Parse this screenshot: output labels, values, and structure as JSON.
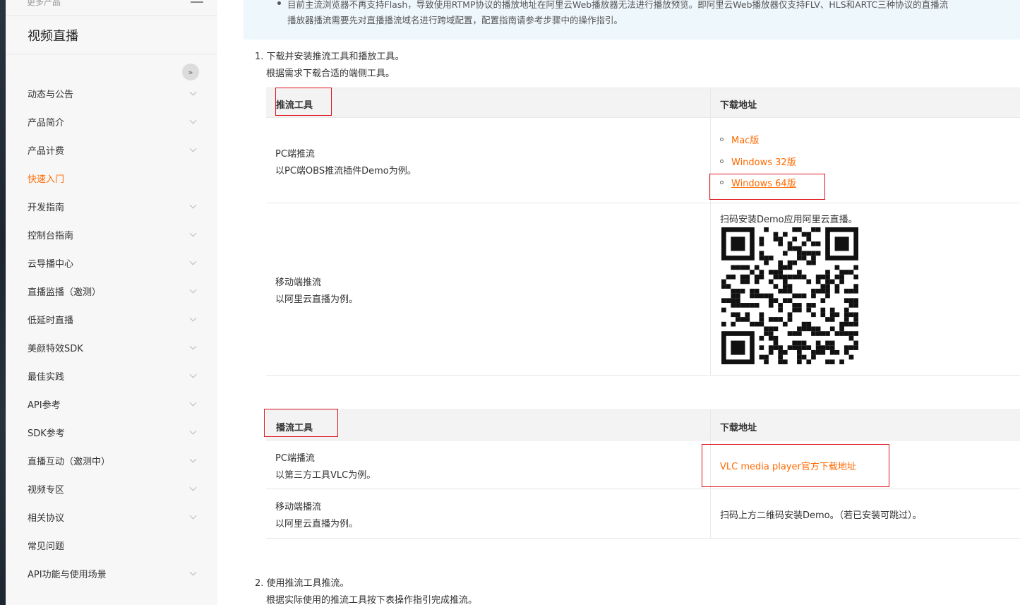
{
  "sidebar": {
    "more_label": "更多产品",
    "title": "视频直播",
    "items": [
      {
        "label": "动态与公告",
        "active": false,
        "expandable": true
      },
      {
        "label": "产品简介",
        "active": false,
        "expandable": true
      },
      {
        "label": "产品计费",
        "active": false,
        "expandable": true
      },
      {
        "label": "快速入门",
        "active": true,
        "expandable": false
      },
      {
        "label": "开发指南",
        "active": false,
        "expandable": true
      },
      {
        "label": "控制台指南",
        "active": false,
        "expandable": true
      },
      {
        "label": "云导播中心",
        "active": false,
        "expandable": true
      },
      {
        "label": "直播监播（邀测）",
        "active": false,
        "expandable": true
      },
      {
        "label": "低延时直播",
        "active": false,
        "expandable": true
      },
      {
        "label": "美颜特效SDK",
        "active": false,
        "expandable": true
      },
      {
        "label": "最佳实践",
        "active": false,
        "expandable": true
      },
      {
        "label": "API参考",
        "active": false,
        "expandable": true
      },
      {
        "label": "SDK参考",
        "active": false,
        "expandable": true
      },
      {
        "label": "直播互动（邀测中）",
        "active": false,
        "expandable": true
      },
      {
        "label": "视频专区",
        "active": false,
        "expandable": true
      },
      {
        "label": "相关协议",
        "active": false,
        "expandable": true
      },
      {
        "label": "常见问题",
        "active": false,
        "expandable": false
      },
      {
        "label": "API功能与使用场景",
        "active": false,
        "expandable": true
      }
    ]
  },
  "notice": {
    "line1": "目前主流浏览器不再支持Flash，导致使用RTMP协议的播放地址在阿里云Web播放器无法进行播放预览。即阿里云Web播放器仅支持FLV、HLS和ARTC三种协议的直播流",
    "line2": "播放器播流需要先对直播播流域名进行跨域配置，配置指南请参考步骤中的操作指引。"
  },
  "step1": {
    "title": "1. 下载并安装推流工具和播放工具。",
    "sub": "根据需求下载合适的端侧工具。"
  },
  "push_table": {
    "col1": "推流工具",
    "col2": "下载地址",
    "rows": [
      {
        "title": "PC端推流",
        "desc": "以PC端OBS推流插件Demo为例。",
        "links": [
          "Mac版",
          "Windows 32版",
          "Windows 64版"
        ]
      },
      {
        "title": "移动端推流",
        "desc": "以阿里云直播为例。",
        "note": "扫码安装Demo应用阿里云直播。"
      }
    ]
  },
  "play_table": {
    "col1": "播流工具",
    "col2": "下载地址",
    "rows": [
      {
        "title": "PC端播流",
        "desc": "以第三方工具VLC为例。",
        "link": "VLC media player官方下载地址"
      },
      {
        "title": "移动端播流",
        "desc": "以阿里云直播为例。",
        "note": "扫码上方二维码安装Demo。（若已安装可跳过）。"
      }
    ]
  },
  "step2": {
    "title": "2. 使用推流工具推流。",
    "sub": "根据实际使用的推流工具按下表操作指引完成推流。"
  },
  "colors": {
    "accent": "#ff6a00",
    "highlight": "#e0141e"
  }
}
